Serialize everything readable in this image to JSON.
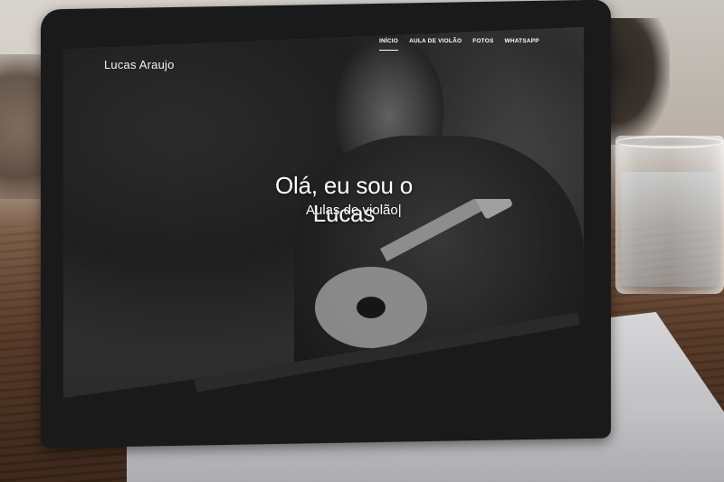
{
  "site": {
    "logo": "Lucas Araujo",
    "nav": [
      {
        "label": "INÍCIO",
        "active": true
      },
      {
        "label": "AULA DE VIOLÃO",
        "active": false
      },
      {
        "label": "FOTOS",
        "active": false
      },
      {
        "label": "WHATSAPP",
        "active": false
      }
    ],
    "hero": {
      "title": "Olá, eu sou o Lucas",
      "subtitle": "Aulas de violão",
      "cursor": "|"
    }
  },
  "colors": {
    "hero_text": "#ffffff",
    "screen_overlay": "#2c2c2c",
    "laptop_bezel": "#1a1a1b",
    "laptop_body": "#c5c5c8",
    "table_wood": "#5b3b28"
  }
}
